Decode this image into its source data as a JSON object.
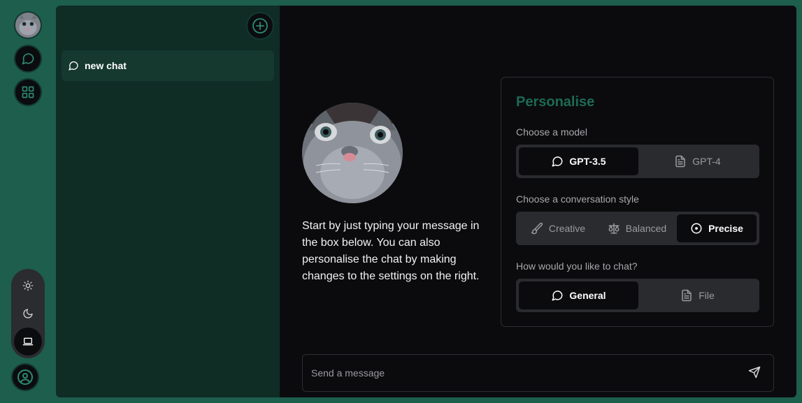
{
  "rail": {
    "items": [
      {
        "name": "profile-avatar",
        "icon": "cat-avatar"
      },
      {
        "name": "chat-nav",
        "icon": "chat-bubble-icon"
      },
      {
        "name": "apps-nav",
        "icon": "grid-icon"
      }
    ],
    "theme_options": [
      "light",
      "dark",
      "system"
    ],
    "theme_selected": "system",
    "account_icon": "user-circle-icon"
  },
  "sidebar": {
    "new_chat_icon": "plus-circle-icon",
    "chats": [
      {
        "label": "new chat",
        "icon": "chat-bubble-icon",
        "active": true
      }
    ]
  },
  "main": {
    "intro_text": "Start by just typing your message in the box below. You can also personalise the chat by making changes to the settings on the right.",
    "personalise": {
      "title": "Personalise",
      "model_label": "Choose a model",
      "models": [
        {
          "label": "GPT-3.5",
          "icon": "chat-bubble-icon",
          "selected": true
        },
        {
          "label": "GPT-4",
          "icon": "document-icon",
          "selected": false
        }
      ],
      "style_label": "Choose a conversation style",
      "styles": [
        {
          "label": "Creative",
          "icon": "brush-icon",
          "selected": false
        },
        {
          "label": "Balanced",
          "icon": "scale-icon",
          "selected": false
        },
        {
          "label": "Precise",
          "icon": "target-icon",
          "selected": true
        }
      ],
      "chat_label": "How would you like to chat?",
      "chat_modes": [
        {
          "label": "General",
          "icon": "chat-bubble-icon",
          "selected": true
        },
        {
          "label": "File",
          "icon": "document-icon",
          "selected": false
        }
      ]
    },
    "composer": {
      "placeholder": "Send a message",
      "value": "",
      "send_icon": "send-icon"
    }
  },
  "colors": {
    "accent": "#1d5e4d",
    "sidebar_bg": "#0f2c25",
    "main_bg": "#0b0b0d",
    "title_green": "#1d6a53"
  }
}
